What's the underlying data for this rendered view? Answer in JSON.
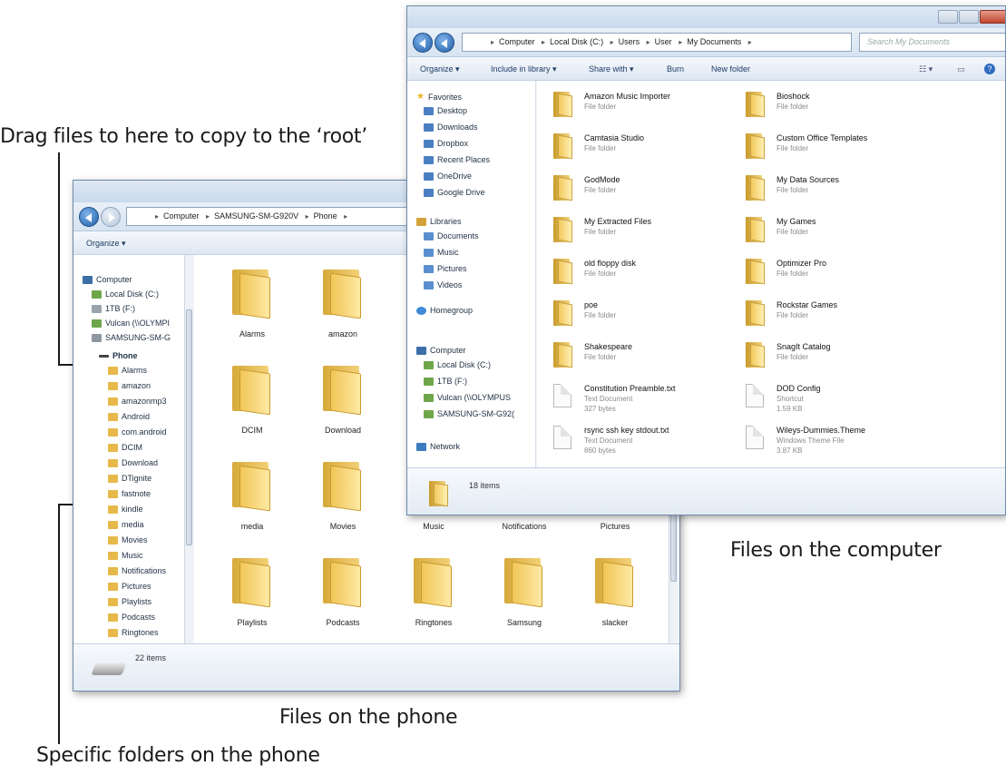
{
  "annotations": {
    "root": "Drag files to here to copy to the ‘root’",
    "computer_files": "Files on the computer",
    "phone_files": "Files on the phone",
    "phone_folders": "Specific folders on the phone"
  },
  "phone_window": {
    "breadcrumb": [
      "Computer",
      "SAMSUNG-SM-G920V",
      "Phone"
    ],
    "toolbar": {
      "organize": "Organize ▾"
    },
    "nav": {
      "computer": "Computer",
      "drives": [
        "Local Disk (C:)",
        "1TB (F:)",
        "Vulcan (\\\\OLYMPI",
        "SAMSUNG-SM-G"
      ],
      "phone": "Phone",
      "folders": [
        "Alarms",
        "amazon",
        "amazonmp3",
        "Android",
        "com.android",
        "DCIM",
        "Download",
        "DTignite",
        "fastnote",
        "kindle",
        "media",
        "Movies",
        "Music",
        "Notifications",
        "Pictures",
        "Playlists",
        "Podcasts",
        "Ringtones"
      ]
    },
    "grid": [
      [
        "Alarms",
        "amazon",
        "",
        "",
        ""
      ],
      [
        "DCIM",
        "Download",
        "",
        "",
        ""
      ],
      [
        "media",
        "Movies",
        "Music",
        "Notifications",
        "Pictures"
      ],
      [
        "Playlists",
        "Podcasts",
        "Ringtones",
        "Samsung",
        "slacker"
      ]
    ],
    "status": "22 items"
  },
  "computer_window": {
    "breadcrumb": [
      "Computer",
      "Local Disk (C:)",
      "Users",
      "User",
      "My Documents"
    ],
    "search_placeholder": "Search My Documents",
    "toolbar": {
      "organize": "Organize ▾",
      "include": "Include in library ▾",
      "share": "Share with ▾",
      "burn": "Burn",
      "new_folder": "New folder"
    },
    "nav": {
      "favorites": "Favorites",
      "favorites_items": [
        "Desktop",
        "Downloads",
        "Dropbox",
        "Recent Places",
        "OneDrive",
        "Google Drive"
      ],
      "libraries": "Libraries",
      "libraries_items": [
        "Documents",
        "Music",
        "Pictures",
        "Videos"
      ],
      "homegroup": "Homegroup",
      "computer": "Computer",
      "computer_items": [
        "Local Disk (C:)",
        "1TB (F:)",
        "Vulcan (\\\\OLYMPUS",
        "SAMSUNG-SM-G92("
      ],
      "network": "Network"
    },
    "items_left": [
      {
        "name": "Amazon Music Importer",
        "sub": "File folder"
      },
      {
        "name": "Camtasia Studio",
        "sub": "File folder"
      },
      {
        "name": "GodMode",
        "sub": "File folder"
      },
      {
        "name": "My Extracted Files",
        "sub": "File folder"
      },
      {
        "name": "old floppy disk",
        "sub": "File folder"
      },
      {
        "name": "poe",
        "sub": "File folder"
      },
      {
        "name": "Shakespeare",
        "sub": "File folder"
      },
      {
        "name": "Constitution Preamble.txt",
        "sub": "Text Document",
        "sub2": "327 bytes"
      },
      {
        "name": "rsync ssh key stdout.txt",
        "sub": "Text Document",
        "sub2": "860 bytes"
      }
    ],
    "items_right": [
      {
        "name": "Bioshock",
        "sub": "File folder"
      },
      {
        "name": "Custom Office Templates",
        "sub": "File folder"
      },
      {
        "name": "My Data Sources",
        "sub": "File folder"
      },
      {
        "name": "My Games",
        "sub": "File folder"
      },
      {
        "name": "Optimizer Pro",
        "sub": "File folder"
      },
      {
        "name": "Rockstar Games",
        "sub": "File folder"
      },
      {
        "name": "SnagIt Catalog",
        "sub": "File folder"
      },
      {
        "name": "DOD Config",
        "sub": "Shortcut",
        "sub2": "1.59 KB"
      },
      {
        "name": "Wileys-Dummies.Theme",
        "sub": "Windows Theme File",
        "sub2": "3.87 KB"
      }
    ],
    "status": "18 items"
  }
}
